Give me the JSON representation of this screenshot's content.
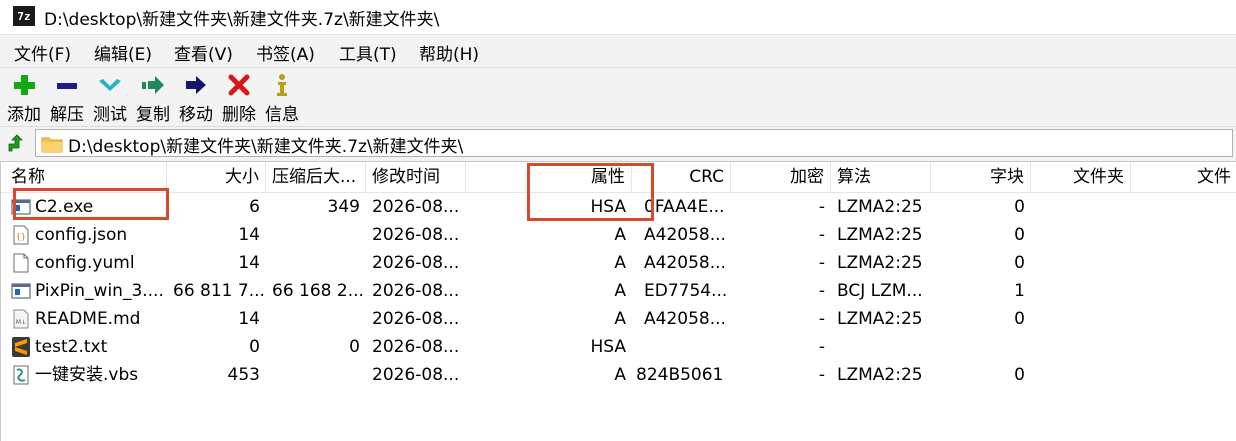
{
  "window": {
    "title": "D:\\desktop\\新建文件夹\\新建文件夹.7z\\新建文件夹\\",
    "app_icon_text": "7z"
  },
  "menu": [
    "文件(F)",
    "编辑(E)",
    "查看(V)",
    "书签(A)",
    "工具(T)",
    "帮助(H)"
  ],
  "toolbar": [
    {
      "label": "添加",
      "icon": "plus-icon",
      "color": "#12a812"
    },
    {
      "label": "解压",
      "icon": "minus-icon",
      "color": "#1c1c8c"
    },
    {
      "label": "测试",
      "icon": "check-chevron-icon",
      "color": "#2ab0c8"
    },
    {
      "label": "复制",
      "icon": "copy-arrow-icon",
      "color": "#1e8a5a"
    },
    {
      "label": "移动",
      "icon": "move-arrow-icon",
      "color": "#14146e"
    },
    {
      "label": "删除",
      "icon": "delete-x-icon",
      "color": "#d81818"
    },
    {
      "label": "信息",
      "icon": "info-icon",
      "color": "#b8a010"
    }
  ],
  "address": {
    "path": "D:\\desktop\\新建文件夹\\新建文件夹.7z\\新建文件夹\\"
  },
  "columns": [
    "名称",
    "大小",
    "压缩后大...",
    "修改时间",
    "属性",
    "CRC",
    "加密",
    "算法",
    "字块",
    "文件夹",
    "文件"
  ],
  "rows": [
    {
      "name": "C2.exe",
      "icon": "exe-icon",
      "size": "6",
      "packed": "349",
      "modified": "2026-08...",
      "attr": "HSA",
      "crc": "0FAA4E...",
      "enc": "-",
      "method": "LZMA2:25",
      "block": "0"
    },
    {
      "name": "config.json",
      "icon": "json-file-icon",
      "size": "14",
      "packed": "",
      "modified": "2026-08...",
      "attr": "A",
      "crc": "A42058...",
      "enc": "-",
      "method": "LZMA2:25",
      "block": "0"
    },
    {
      "name": "config.yuml",
      "icon": "file-icon",
      "size": "14",
      "packed": "",
      "modified": "2026-08...",
      "attr": "A",
      "crc": "A42058...",
      "enc": "-",
      "method": "LZMA2:25",
      "block": "0"
    },
    {
      "name": "PixPin_win_3....",
      "icon": "exe-icon",
      "size": "66 811 7...",
      "packed": "66 168 2...",
      "modified": "2026-08...",
      "attr": "A",
      "crc": "ED7754...",
      "enc": "-",
      "method": "BCJ LZM...",
      "block": "1"
    },
    {
      "name": "README.md",
      "icon": "markdown-file-icon",
      "size": "14",
      "packed": "",
      "modified": "2026-08...",
      "attr": "A",
      "crc": "A42058...",
      "enc": "-",
      "method": "LZMA2:25",
      "block": "0"
    },
    {
      "name": "test2.txt",
      "icon": "sublime-text-icon",
      "size": "0",
      "packed": "0",
      "modified": "2026-08...",
      "attr": "HSA",
      "crc": "",
      "enc": "-",
      "method": "",
      "block": ""
    },
    {
      "name": "一键安装.vbs",
      "icon": "vbs-script-icon",
      "size": "453",
      "packed": "",
      "modified": "2026-08...",
      "attr": "A",
      "crc": "824B5061",
      "enc": "-",
      "method": "LZMA2:25",
      "block": "0"
    }
  ],
  "annotation_color": "#d64a2c"
}
